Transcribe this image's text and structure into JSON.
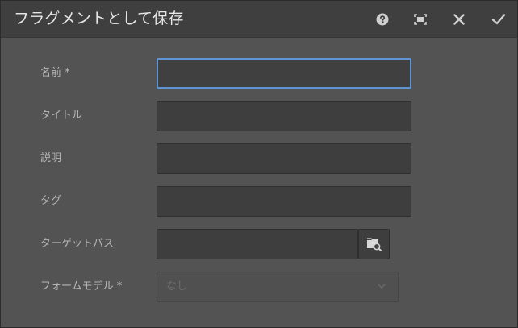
{
  "dialog": {
    "title": "フラグメントとして保存",
    "icons": {
      "help": "help-circle-icon",
      "fullscreen": "fullscreen-icon",
      "close": "close-icon",
      "confirm": "checkmark-icon"
    }
  },
  "form": {
    "name": {
      "label": "名前 *",
      "value": ""
    },
    "title": {
      "label": "タイトル",
      "value": ""
    },
    "description": {
      "label": "説明",
      "value": ""
    },
    "tags": {
      "label": "タグ",
      "value": ""
    },
    "target_path": {
      "label": "ターゲットパス",
      "value": "",
      "browse_icon": "folder-search-icon"
    },
    "form_model": {
      "label": "フォームモデル *",
      "selected": "なし",
      "disabled": true
    }
  },
  "colors": {
    "focus_border": "#5f94d4",
    "titlebar_bg": "#3f3f3f",
    "dialog_bg": "#535353"
  }
}
